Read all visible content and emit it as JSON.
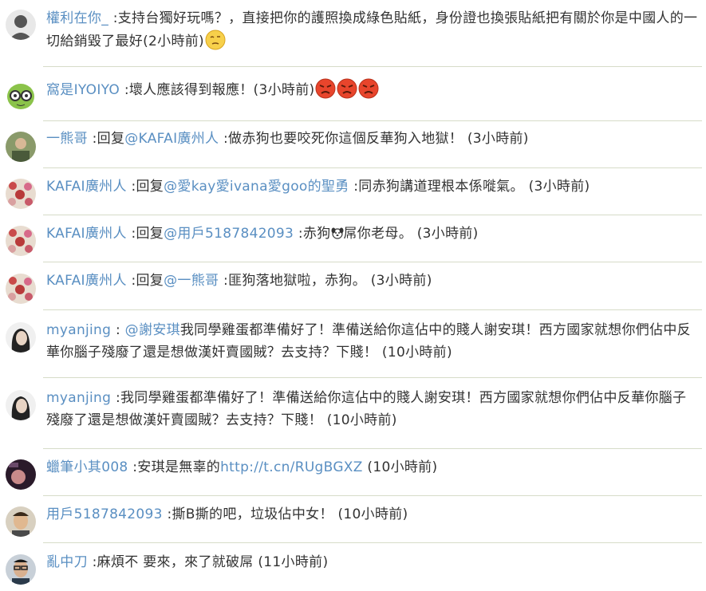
{
  "comments": [
    {
      "user": "權利在你_",
      "prefix": "",
      "mention": "",
      "text": "支持台獨好玩嗎？，直接把你的護照換成綠色貼紙，身份證也換張貼紙把有關於你是中國人的一切給銷毀了最好",
      "time": "(2小時前)",
      "avatar": "gray-silhouette-avatar"
    },
    {
      "user": "窩是IYOIYO",
      "prefix": "",
      "mention": "",
      "text": "壞人應該得到報應！",
      "time": "(3小時前)",
      "avatar": "green-cartoon-avatar"
    },
    {
      "user": "一熊哥",
      "prefix": "回复",
      "mention": "@KAFAI廣州人",
      "text": "做赤狗也要咬死你這個反華狗入地獄！",
      "time": "(3小時前)",
      "avatar": "photo-avatar"
    },
    {
      "user": "KAFAI廣州人",
      "prefix": "回复",
      "mention": "@愛kay愛ivana愛goo的聖勇",
      "text": "同赤狗講道理根本係嘥氣。",
      "time": "(3小時前)",
      "avatar": "floral-avatar"
    },
    {
      "user": "KAFAI廣州人",
      "prefix": "回复",
      "mention": "@用戶5187842093",
      "text_a": "赤狗",
      "text_b": "屌你老母。",
      "time": "(3小時前)",
      "avatar": "floral-avatar"
    },
    {
      "user": "KAFAI廣州人",
      "prefix": "回复",
      "mention": "@一熊哥",
      "text": "匪狗落地獄啦，赤狗。",
      "time": "(3小時前)",
      "avatar": "floral-avatar"
    },
    {
      "user": "myanjing",
      "prefix": "",
      "mention": "@謝安琪",
      "text": "我同學雞蛋都準備好了！準備送給你這佔中的賤人謝安琪！西方國家就想你們佔中反華你腦子殘廢了還是想做漢奸賣國賊？去支持？下賤！",
      "time": "(10小時前)",
      "avatar": "woman-photo-avatar"
    },
    {
      "user": "myanjing",
      "prefix": "",
      "mention": "",
      "text": "我同學雞蛋都準備好了！準備送給你這佔中的賤人謝安琪！西方國家就想你們佔中反華你腦子殘廢了還是想做漢奸賣國賊？去支持？下賤！",
      "time": "(10小時前)",
      "avatar": "woman-photo-avatar"
    },
    {
      "user": "蠟筆小其008",
      "prefix": "",
      "mention": "",
      "text": "安琪是無辜的",
      "link": "http://t.cn/RUgBGXZ",
      "time": "(10小時前)",
      "avatar": "dark-photo-avatar"
    },
    {
      "user": "用戶5187842093",
      "prefix": "",
      "mention": "",
      "text": "撕B撕的吧，垃圾佔中女！",
      "time": "(10小時前)",
      "avatar": "man-photo-avatar"
    },
    {
      "user": "亂中刀",
      "prefix": "",
      "mention": "",
      "text": "麻煩不 要來，來了就破屌",
      "time": "(11小時前)",
      "avatar": "man-glasses-avatar"
    }
  ],
  "colors": {
    "link": "#5a8fc2",
    "text": "#333333",
    "separator": "#d6dcc8"
  }
}
